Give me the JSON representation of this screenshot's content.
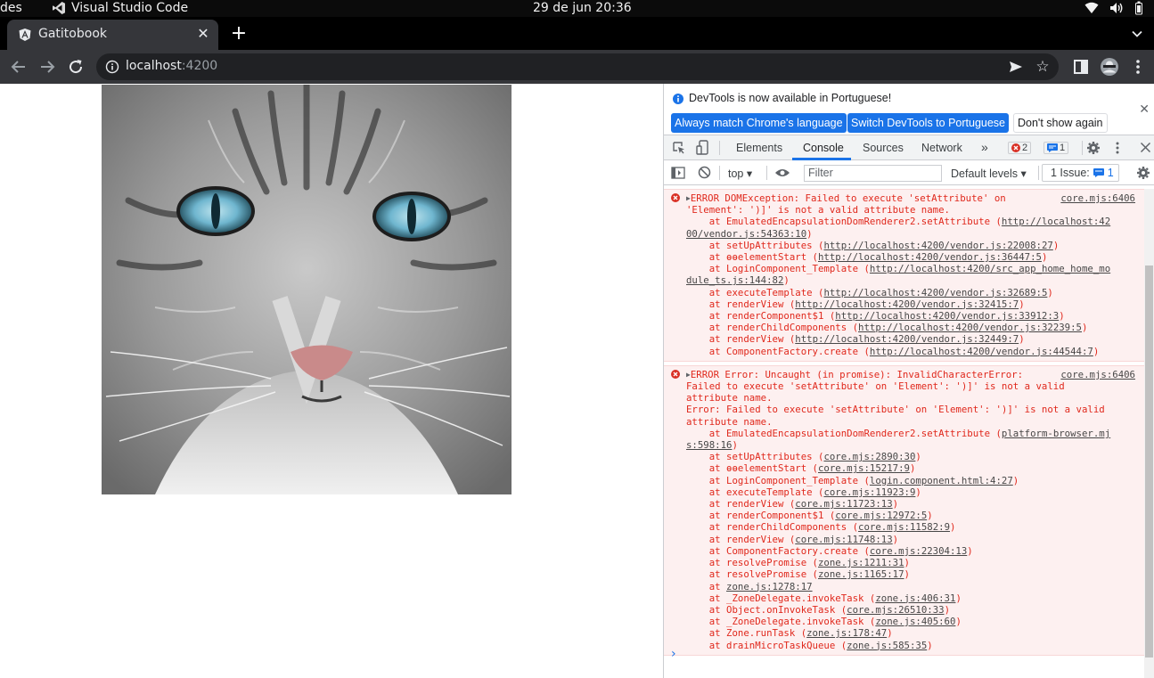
{
  "os": {
    "activities": "des",
    "app_name": "Visual Studio Code",
    "clock": "29 de jun  20:36"
  },
  "browser": {
    "tab_title": "Gatitobook",
    "url_host": "localhost",
    "url_port": ":4200"
  },
  "page": {
    "image_alt": "Cat face"
  },
  "devtools": {
    "infobar": {
      "message": "DevTools is now available in Portuguese!",
      "btn_match": "Always match Chrome's language",
      "btn_switch": "Switch DevTools to Portuguese",
      "btn_dont": "Don't show again"
    },
    "tabs": [
      "Elements",
      "Console",
      "Sources",
      "Network"
    ],
    "more": "»",
    "errors_count": "2",
    "messages_count": "1",
    "console_bar": {
      "context": "top",
      "filter_placeholder": "Filter",
      "levels": "Default levels",
      "issues_label": "1 Issue:",
      "issues_count": "1"
    },
    "messages": [
      {
        "source": "core.mjs:6406",
        "head": "ERROR DOMException: Failed to execute 'setAttribute' on",
        "lines": [
          {
            "t": "'Element': ')]' is not a valid attribute name."
          },
          {
            "t": "    at EmulatedEncapsulationDomRenderer2.setAttribute (",
            "l": "http://localhost:42"
          },
          {
            "t": "",
            "l": "00/vendor.js:54363:10",
            "e": ")"
          },
          {
            "t": "    at setUpAttributes (",
            "l": "http://localhost:4200/vendor.js:22008:27",
            "e": ")"
          },
          {
            "t": "    at ɵɵelementStart (",
            "l": "http://localhost:4200/vendor.js:36447:5",
            "e": ")"
          },
          {
            "t": "    at LoginComponent_Template (",
            "l": "http://localhost:4200/src_app_home_home_mo"
          },
          {
            "t": "",
            "l": "dule_ts.js:144:82",
            "e": ")"
          },
          {
            "t": "    at executeTemplate (",
            "l": "http://localhost:4200/vendor.js:32689:5",
            "e": ")"
          },
          {
            "t": "    at renderView (",
            "l": "http://localhost:4200/vendor.js:32415:7",
            "e": ")"
          },
          {
            "t": "    at renderComponent$1 (",
            "l": "http://localhost:4200/vendor.js:33912:3",
            "e": ")"
          },
          {
            "t": "    at renderChildComponents (",
            "l": "http://localhost:4200/vendor.js:32239:5",
            "e": ")"
          },
          {
            "t": "    at renderView (",
            "l": "http://localhost:4200/vendor.js:32449:7",
            "e": ")"
          },
          {
            "t": "    at ComponentFactory.create (",
            "l": "http://localhost:4200/vendor.js:44544:7",
            "e": ")"
          }
        ]
      },
      {
        "source": "core.mjs:6406",
        "head": "ERROR Error: Uncaught (in promise): InvalidCharacterError:",
        "lines": [
          {
            "t": "Failed to execute 'setAttribute' on 'Element': ')]' is not a valid"
          },
          {
            "t": "attribute name."
          },
          {
            "t": "Error: Failed to execute 'setAttribute' on 'Element': ')]' is not a valid"
          },
          {
            "t": "attribute name."
          },
          {
            "t": "    at EmulatedEncapsulationDomRenderer2.setAttribute (",
            "l": "platform-browser.mj"
          },
          {
            "t": "",
            "l": "s:598:16",
            "e": ")"
          },
          {
            "t": "    at setUpAttributes (",
            "l": "core.mjs:2890:30",
            "e": ")"
          },
          {
            "t": "    at ɵɵelementStart (",
            "l": "core.mjs:15217:9",
            "e": ")"
          },
          {
            "t": "    at LoginComponent_Template (",
            "l": "login.component.html:4:27",
            "e": ")"
          },
          {
            "t": "    at executeTemplate (",
            "l": "core.mjs:11923:9",
            "e": ")"
          },
          {
            "t": "    at renderView (",
            "l": "core.mjs:11723:13",
            "e": ")"
          },
          {
            "t": "    at renderComponent$1 (",
            "l": "core.mjs:12972:5",
            "e": ")"
          },
          {
            "t": "    at renderChildComponents (",
            "l": "core.mjs:11582:9",
            "e": ")"
          },
          {
            "t": "    at renderView (",
            "l": "core.mjs:11748:13",
            "e": ")"
          },
          {
            "t": "    at ComponentFactory.create (",
            "l": "core.mjs:22304:13",
            "e": ")"
          },
          {
            "t": "    at resolvePromise (",
            "l": "zone.js:1211:31",
            "e": ")"
          },
          {
            "t": "    at resolvePromise (",
            "l": "zone.js:1165:17",
            "e": ")"
          },
          {
            "t": "    at ",
            "l": "zone.js:1278:17"
          },
          {
            "t": "    at _ZoneDelegate.invokeTask (",
            "l": "zone.js:406:31",
            "e": ")"
          },
          {
            "t": "    at Object.onInvokeTask (",
            "l": "core.mjs:26510:33",
            "e": ")"
          },
          {
            "t": "    at _ZoneDelegate.invokeTask (",
            "l": "zone.js:405:60",
            "e": ")"
          },
          {
            "t": "    at Zone.runTask (",
            "l": "zone.js:178:47",
            "e": ")"
          },
          {
            "t": "    at drainMicroTaskQueue (",
            "l": "zone.js:585:35",
            "e": ")"
          }
        ]
      }
    ],
    "prompt": "›"
  },
  "colors": {
    "error": "#e0281c",
    "accent": "#1a73e8",
    "error_bg": "#fdf0f0"
  }
}
